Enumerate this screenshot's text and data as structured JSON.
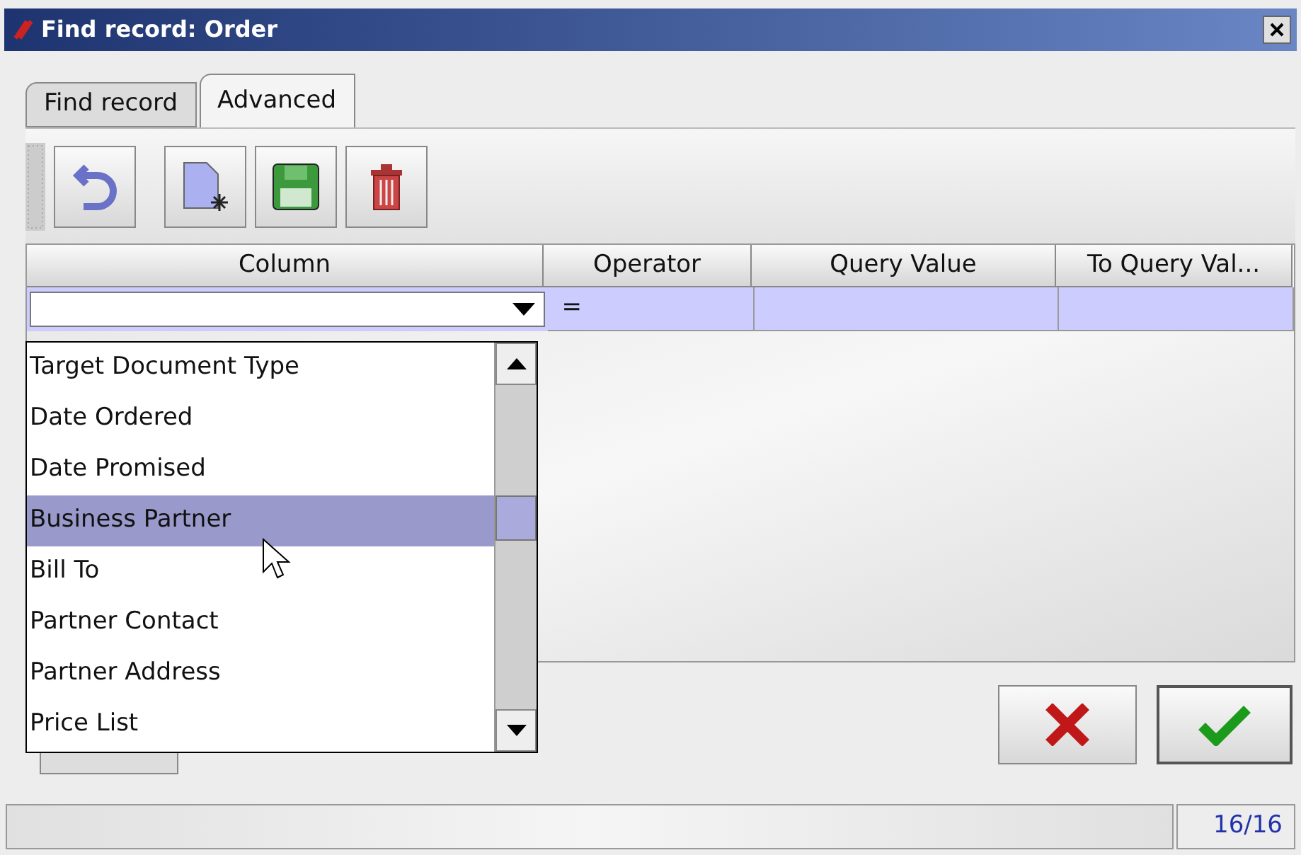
{
  "window": {
    "title": "Find record: Order"
  },
  "tabs": [
    {
      "label": "Find record",
      "selected": false
    },
    {
      "label": "Advanced",
      "selected": true
    }
  ],
  "table": {
    "columns": [
      "Column",
      "Operator",
      "Query Value",
      "To Query Val..."
    ],
    "rows": [
      {
        "column": "",
        "operator": "=",
        "query_value": "",
        "to_query_value": ""
      }
    ]
  },
  "dropdown": {
    "items": [
      {
        "label": "Target Document Type",
        "selected": false
      },
      {
        "label": "Date Ordered",
        "selected": false
      },
      {
        "label": "Date Promised",
        "selected": false
      },
      {
        "label": "Business Partner",
        "selected": true
      },
      {
        "label": "Bill To",
        "selected": false
      },
      {
        "label": "Partner Contact",
        "selected": false
      },
      {
        "label": "Partner Address",
        "selected": false
      },
      {
        "label": "Price List",
        "selected": false
      }
    ]
  },
  "status_bar": {
    "count": "16/16"
  }
}
